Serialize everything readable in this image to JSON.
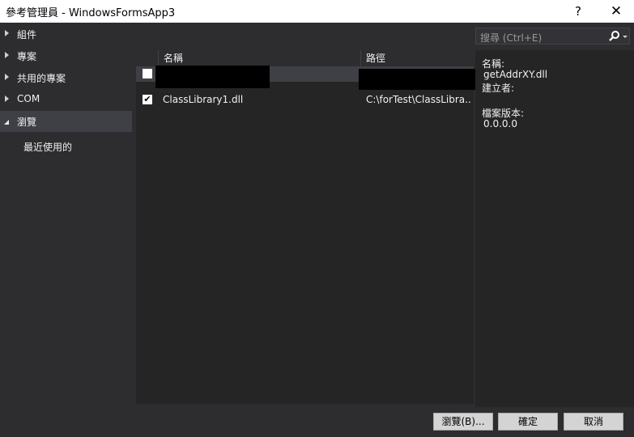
{
  "window": {
    "title": "參考管理員 - WindowsFormsApp3",
    "help": "?",
    "close": "✕"
  },
  "nav": {
    "items": [
      {
        "label": "組件",
        "expanded": false
      },
      {
        "label": "專案",
        "expanded": false
      },
      {
        "label": "共用的專案",
        "expanded": false
      },
      {
        "label": "COM",
        "expanded": false
      },
      {
        "label": "瀏覽",
        "expanded": true,
        "selected": true
      }
    ],
    "subitem": "最近使用的"
  },
  "list": {
    "columns": {
      "name": "名稱",
      "path": "路徑"
    },
    "rows": [
      {
        "checked": false,
        "name": "",
        "path": "",
        "redacted": true,
        "selected": true
      },
      {
        "checked": true,
        "name": "ClassLibrary1.dll",
        "path": "C:\\forTest\\ClassLibra..."
      }
    ]
  },
  "search": {
    "placeholder": "搜尋 (Ctrl+E)",
    "icon": "search-icon"
  },
  "details": {
    "name_label": "名稱:",
    "name_value": "getAddrXY.dll",
    "creator_label": "建立者:",
    "version_label": "檔案版本:",
    "version_value": "0.0.0.0"
  },
  "buttons": {
    "browse": "瀏覽(B)...",
    "ok": "確定",
    "cancel": "取消"
  }
}
